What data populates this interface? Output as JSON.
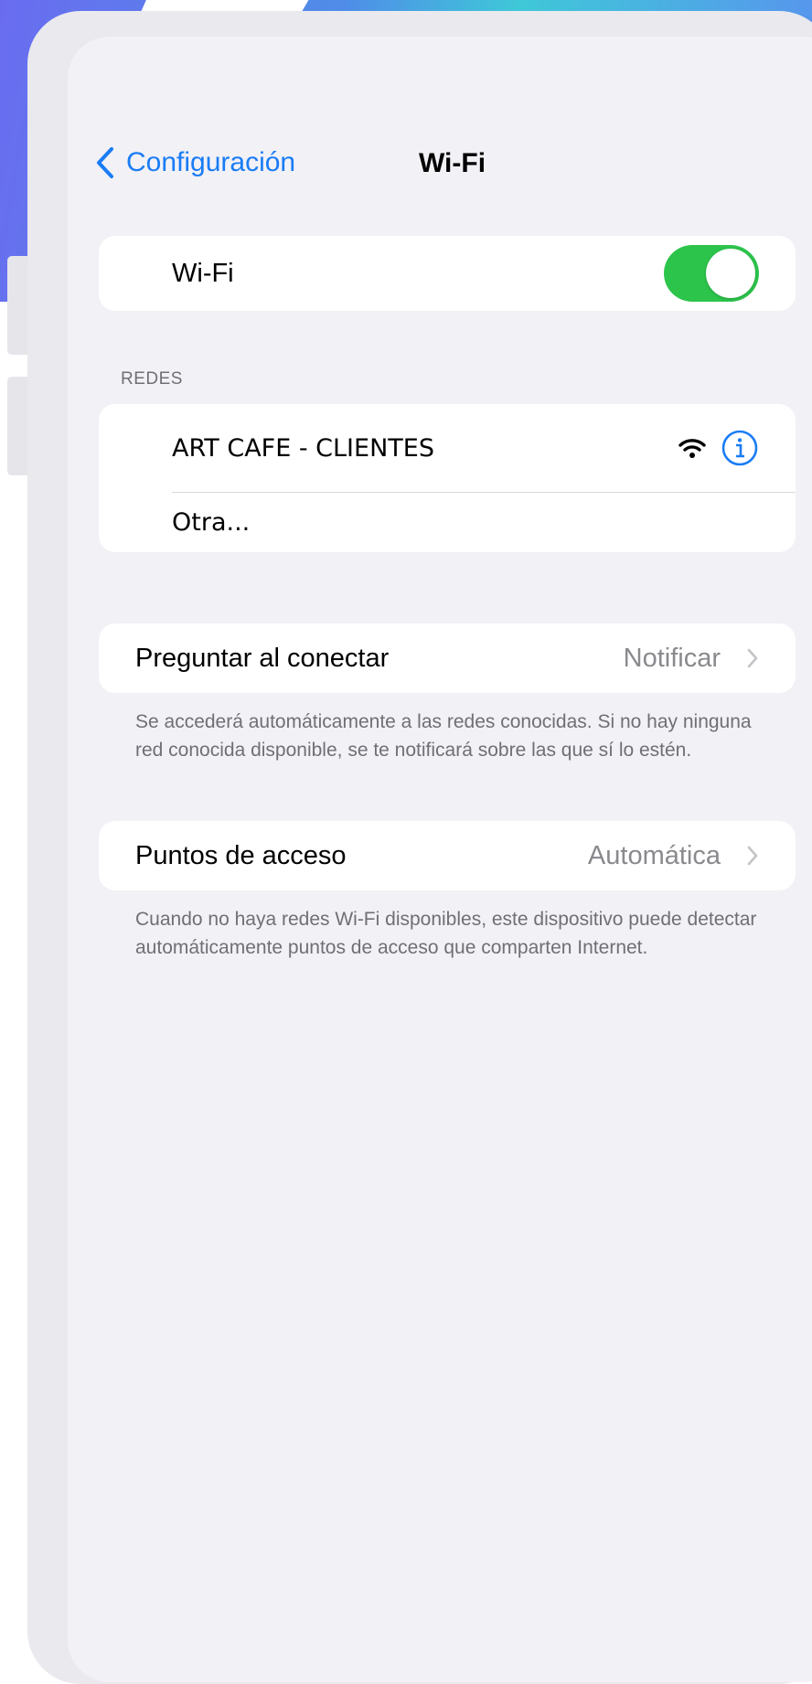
{
  "nav": {
    "back_label": "Configuración",
    "title": "Wi-Fi"
  },
  "wifi": {
    "label": "Wi-Fi",
    "enabled": true
  },
  "networks": {
    "header": "REDES",
    "items": [
      {
        "name": "ART CAFE - CLIENTES"
      },
      {
        "name": "Otra..."
      }
    ]
  },
  "ask_join": {
    "label": "Preguntar al conectar",
    "value": "Notificar",
    "note": "Se accederá automáticamente a las redes conocidas. Si no hay ninguna red conocida disponible, se te notificará sobre las que sí lo estén."
  },
  "hotspot": {
    "label": "Puntos de acceso",
    "value": "Automática",
    "note": "Cuando no haya redes Wi-Fi disponibles, este dispositivo puede detectar automáticamente puntos de acceso que comparten Internet."
  },
  "colors": {
    "accent": "#1a7cf5",
    "toggle_on": "#2dc44c",
    "screen_bg": "#f1f1f6"
  },
  "icons": [
    "chevron-left-icon",
    "wifi-signal-icon",
    "info-icon",
    "chevron-right-icon"
  ]
}
